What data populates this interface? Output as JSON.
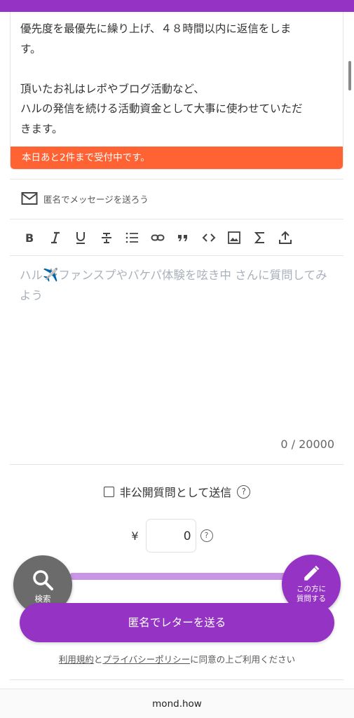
{
  "colors": {
    "brand": "#9534c4",
    "notice": "#ff6333",
    "placeholder": "#a9b1bb",
    "search_fab": "#6b6b6b",
    "slider": "#c995e4"
  },
  "card": {
    "line1": "優先度を最優先に繰り上げ、４８時間以内に返信をしま",
    "line2": "す。",
    "line3": "頂いたお礼はレポやブログ活動など、",
    "line4": "ハルの発信を続ける活動資金として大事に使わせていただ",
    "line5": "きます。",
    "notice": "本日あと2件まで受付中です。"
  },
  "anon": {
    "icon": "mail-icon",
    "label": "匿名でメッセージを送ろう"
  },
  "toolbar": {
    "items": [
      {
        "icon": "bold-icon"
      },
      {
        "icon": "italic-icon"
      },
      {
        "icon": "underline-icon"
      },
      {
        "icon": "strikethrough-icon"
      },
      {
        "icon": "list-icon"
      },
      {
        "icon": "link-icon"
      },
      {
        "icon": "quote-icon"
      },
      {
        "icon": "code-icon"
      },
      {
        "icon": "image-icon"
      },
      {
        "icon": "sigma-icon"
      },
      {
        "icon": "upload-icon"
      }
    ]
  },
  "editor": {
    "placeholder_prefix": "ハル",
    "placeholder_emoji": "✈️",
    "placeholder_suffix": "ファンスプやバケパ体験を呟き中 さんに質問してみよう"
  },
  "char_count": "0 / 20000",
  "private": {
    "label": "非公開質問として送信",
    "help": "?"
  },
  "amount": {
    "currency": "¥",
    "value": "0",
    "help": "?"
  },
  "fab_search": {
    "icon": "search-icon",
    "label": "検索"
  },
  "fab_ask": {
    "icon": "pencil-icon",
    "label_line1": "この方に",
    "label_line2": "質問する"
  },
  "send_button": "匿名でレターを送る",
  "terms": {
    "link1": "利用規約",
    "and": "と",
    "link2": "プライバシーポリシー",
    "rest": "に同意の上ご利用ください"
  },
  "footer": "mond.how"
}
